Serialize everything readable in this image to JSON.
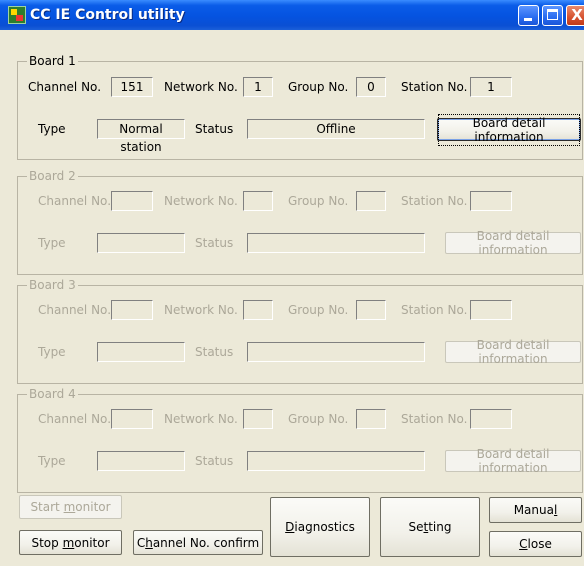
{
  "window": {
    "title": "CC IE Control utility"
  },
  "titlebar_buttons": {
    "close_glyph": "X"
  },
  "labels": {
    "channel_no": "Channel No.",
    "network_no": "Network No.",
    "group_no": "Group No.",
    "station_no": "Station No.",
    "type": "Type",
    "status": "Status",
    "board_detail": "Board detail information"
  },
  "boards": [
    {
      "title": "Board 1",
      "enabled": true,
      "channel_no": "151",
      "network_no": "1",
      "group_no": "0",
      "station_no": "1",
      "type": "Normal station",
      "status": "Offline"
    },
    {
      "title": "Board 2",
      "enabled": false,
      "channel_no": "",
      "network_no": "",
      "group_no": "",
      "station_no": "",
      "type": "",
      "status": ""
    },
    {
      "title": "Board 3",
      "enabled": false,
      "channel_no": "",
      "network_no": "",
      "group_no": "",
      "station_no": "",
      "type": "",
      "status": ""
    },
    {
      "title": "Board 4",
      "enabled": false,
      "channel_no": "",
      "network_no": "",
      "group_no": "",
      "station_no": "",
      "type": "",
      "status": ""
    }
  ],
  "buttons": {
    "start_monitor": {
      "pre": "Start ",
      "ul": "m",
      "post": "onitor"
    },
    "stop_monitor": {
      "pre": "Stop ",
      "ul": "m",
      "post": "onitor"
    },
    "channel_confirm": {
      "pre": "C",
      "ul": "h",
      "post": "annel No. confirm"
    },
    "diagnostics": {
      "pre": "",
      "ul": "D",
      "post": "iagnostics"
    },
    "setting": {
      "pre": "Se",
      "ul": "t",
      "post": "ting"
    },
    "manual": {
      "pre": "Manua",
      "ul": "l",
      "post": ""
    },
    "close": {
      "pre": "",
      "ul": "C",
      "post": "lose"
    }
  }
}
